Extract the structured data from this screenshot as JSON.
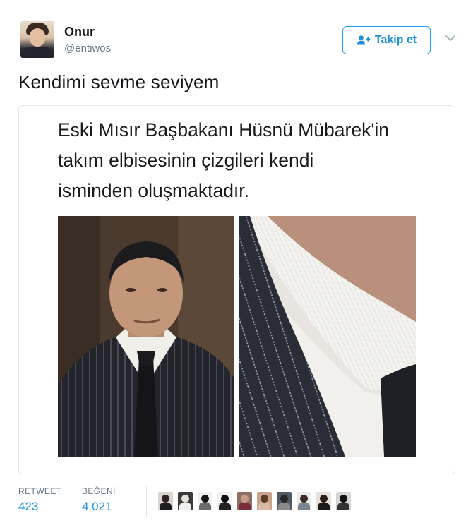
{
  "user": {
    "name": "Onur",
    "handle": "@entiwos"
  },
  "follow_button": {
    "label": "Takip et",
    "icon": "add-user-icon",
    "color": "#1da1f2"
  },
  "more_menu": {
    "icon": "chevron-down-icon"
  },
  "tweet": {
    "text": "Kendimi sevme seviyem"
  },
  "media": {
    "caption_lines": [
      "Eski Mısır Başbakanı Hüsnü Mübarek'in",
      "takım elbisesinin çizgileri kendi",
      "isminden oluşmaktadır."
    ]
  },
  "stats": {
    "retweets_label": "RETWEET",
    "retweets": "423",
    "likes_label": "BEĞENİ",
    "likes": "4.021"
  },
  "likers_count_shown": 10,
  "colors": {
    "accent": "#1da1f2",
    "text_primary": "#14171a",
    "text_secondary": "#657786",
    "border": "#e1e8ed"
  }
}
